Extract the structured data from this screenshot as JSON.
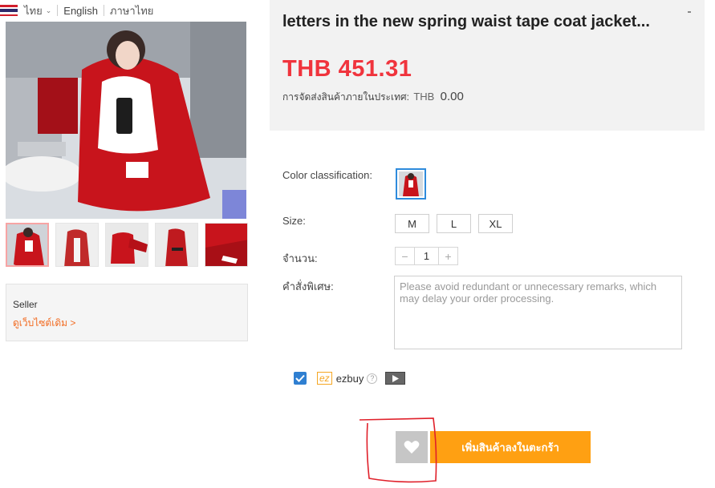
{
  "lang_bar": {
    "current": "ไทย",
    "options": [
      "English",
      "ภาษาไทย"
    ]
  },
  "product": {
    "title": "letters in the new spring waist tape coat jacket...",
    "price": "THB 451.31",
    "shipping_label": "การจัดส่งสินค้าภายในประเทศ:",
    "shipping_currency": "THB",
    "shipping_amount": "0.00"
  },
  "seller": {
    "label": "Seller",
    "link": "ดูเว็บไซต์เดิม >"
  },
  "options": {
    "color_label": "Color classification:",
    "size_label": "Size:",
    "sizes": [
      "M",
      "L",
      "XL"
    ],
    "quantity_label": "จำนวน:",
    "quantity": "1",
    "remarks_label": "คำสั่งพิเศษ:",
    "remarks_placeholder": "Please avoid redundant or unnecessary remarks, which may delay your order processing."
  },
  "ezbuy": {
    "logo": "ez",
    "name": "ezbuy",
    "checked": true
  },
  "actions": {
    "add_to_cart": "เพิ่มสินค้าลงในตะกร้า"
  },
  "colors": {
    "price_red": "#f0343d",
    "cart_orange": "#ffa012",
    "link_orange": "#f26b21",
    "annotation_red": "#e0202a",
    "product_red": "#c8141c"
  },
  "icons": [
    "thai-flag-icon",
    "chevron-down-icon",
    "checkbox-icon",
    "help-icon",
    "play-icon",
    "heart-icon"
  ]
}
